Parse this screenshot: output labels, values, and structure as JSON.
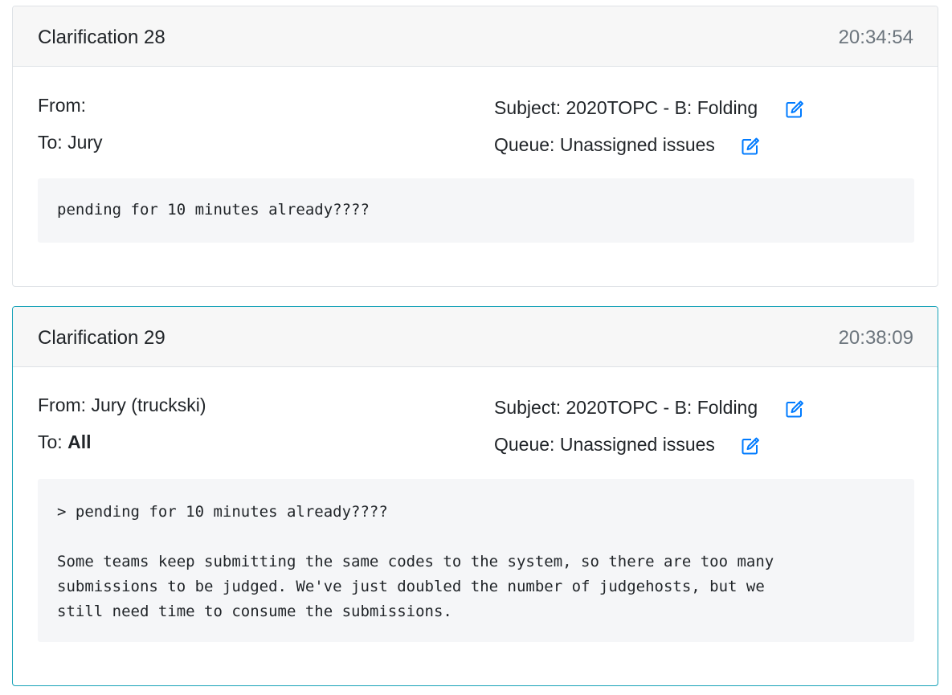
{
  "clarifications": [
    {
      "title": "Clarification 28",
      "time": "20:34:54",
      "from_label": "From:",
      "from_value": "",
      "to_label": "To:",
      "to_value": "Jury",
      "subject_label": "Subject:",
      "subject_value": "2020TOPC - B: Folding",
      "queue_label": "Queue:",
      "queue_value": "Unassigned issues",
      "body": "pending for 10 minutes already????"
    },
    {
      "title": "Clarification 29",
      "time": "20:38:09",
      "from_label": "From:",
      "from_value": "Jury (truckski)",
      "to_label": "To:",
      "to_value": "All",
      "subject_label": "Subject:",
      "subject_value": "2020TOPC - B: Folding",
      "queue_label": "Queue:",
      "queue_value": "Unassigned issues",
      "body": "> pending for 10 minutes already????\n\nSome teams keep submitting the same codes to the system, so there are too many\nsubmissions to be judged. We've just doubled the number of judgehosts, but we\nstill need time to consume the submissions."
    }
  ],
  "icons": {
    "edit": "edit-icon"
  },
  "colors": {
    "icon_blue": "#007bff",
    "active_border": "#17a2b8",
    "time_gray": "#6c757d"
  }
}
